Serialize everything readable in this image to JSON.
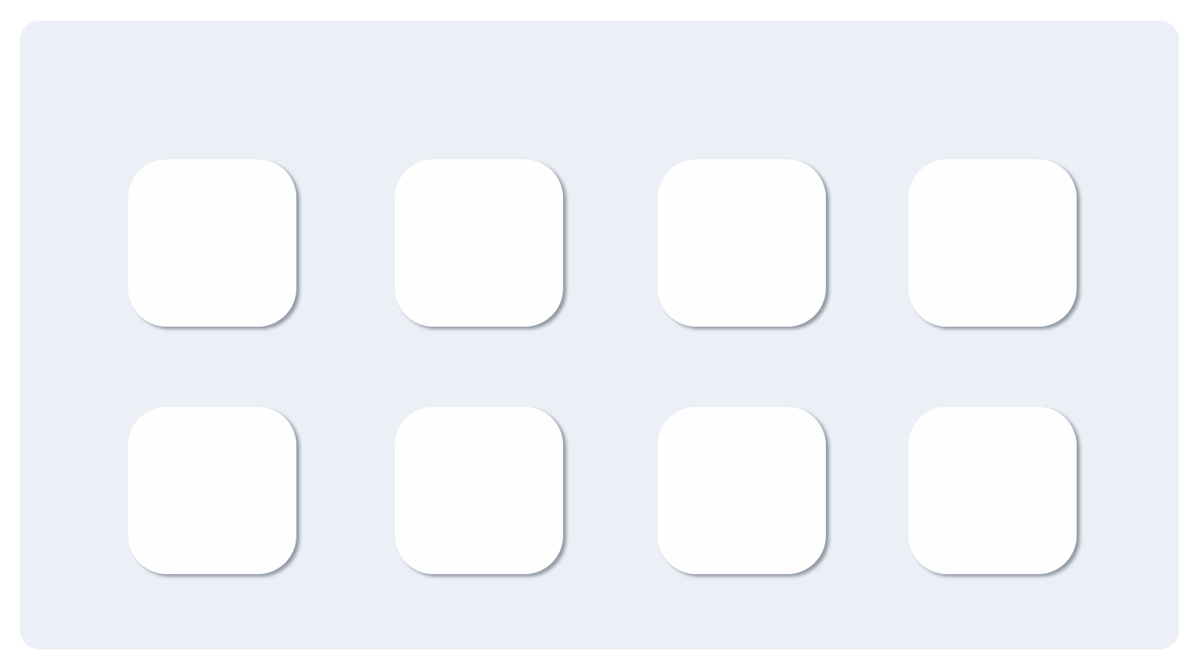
{
  "panel": {
    "background_color": "#ecf0f6"
  },
  "tiles": [
    {
      "row": 1,
      "column": 1,
      "label": ""
    },
    {
      "row": 1,
      "column": 2,
      "label": ""
    },
    {
      "row": 1,
      "column": 3,
      "label": ""
    },
    {
      "row": 1,
      "column": 4,
      "label": ""
    },
    {
      "row": 2,
      "column": 1,
      "label": ""
    },
    {
      "row": 2,
      "column": 2,
      "label": ""
    },
    {
      "row": 2,
      "column": 3,
      "label": ""
    },
    {
      "row": 2,
      "column": 4,
      "label": ""
    }
  ],
  "colors": {
    "page": "#ffffff",
    "tile": "#fefefe",
    "tile_shadow": "#7a828c"
  }
}
